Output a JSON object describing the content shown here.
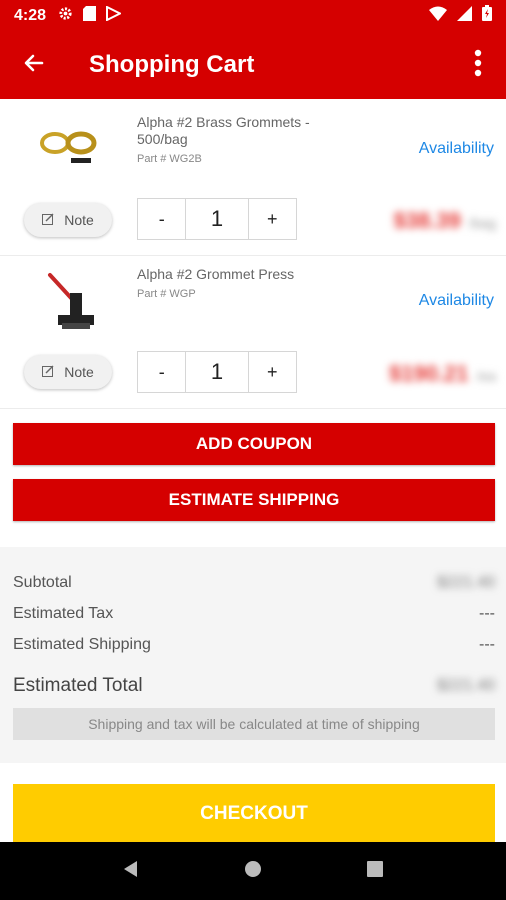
{
  "status_bar": {
    "time": "4:28",
    "icons": [
      "gear-icon",
      "sd-card-icon",
      "play-store-icon",
      "wifi-icon",
      "signal-icon",
      "battery-icon"
    ]
  },
  "app_bar": {
    "title": "Shopping Cart",
    "back_icon": "arrow-left-icon",
    "more_icon": "more-vert-icon"
  },
  "cart": {
    "items": [
      {
        "name": "Alpha #2 Brass Grommets - 500/bag",
        "part": "Part # WG2B",
        "availability": "Availability",
        "note_label": "Note",
        "quantity": "1",
        "price": "$38.39",
        "unit": "/bag"
      },
      {
        "name": "Alpha #2 Grommet Press",
        "part": "Part # WGP",
        "availability": "Availability",
        "note_label": "Note",
        "quantity": "1",
        "price": "$190.21",
        "unit": "/ea"
      }
    ],
    "qty_minus": "-",
    "qty_plus": "+"
  },
  "actions": {
    "add_coupon": "ADD COUPON",
    "estimate_shipping": "ESTIMATE SHIPPING"
  },
  "summary": {
    "subtotal_label": "Subtotal",
    "subtotal_value": "$221.40",
    "tax_label": "Estimated Tax",
    "tax_value": "---",
    "shipping_label": "Estimated Shipping",
    "shipping_value": "---",
    "total_label": "Estimated Total",
    "total_value": "$221.40",
    "notice": "Shipping and tax will be calculated at time of shipping"
  },
  "checkout": {
    "label": "CHECKOUT"
  },
  "colors": {
    "brand_red": "#d50000",
    "checkout_yellow": "#ffcc00",
    "link_blue": "#1e88e5"
  }
}
